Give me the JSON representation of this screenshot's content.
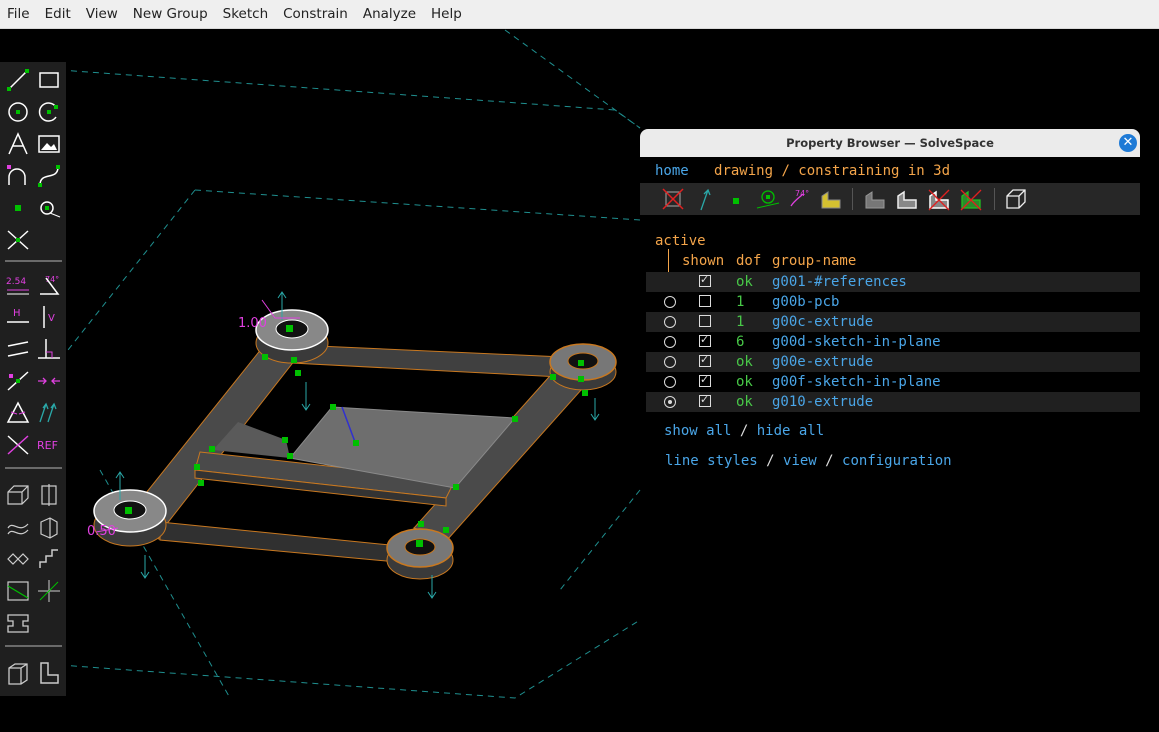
{
  "menubar": {
    "items": [
      "File",
      "Edit",
      "View",
      "New Group",
      "Sketch",
      "Constrain",
      "Analyze",
      "Help"
    ]
  },
  "viewport": {
    "dimension_labels": [
      "1.00",
      "0.50"
    ]
  },
  "toolbar": {
    "icons": [
      "line-icon",
      "rectangle-icon",
      "circle-icon",
      "arc-icon",
      "text-icon",
      "image-icon",
      "tangent-arc-icon",
      "bezier-icon",
      "point-icon",
      "workplane-icon",
      "split-icon",
      "distance-icon",
      "angle-icon",
      "horizontal-icon",
      "vertical-icon",
      "parallel-icon",
      "perpendicular-icon",
      "point-on-icon",
      "symmetric-icon",
      "equal-icon",
      "same-orientation-icon",
      "other-supplement-icon",
      "reference-icon",
      "extrude-icon",
      "lathe-icon",
      "helix-icon",
      "revolve-icon",
      "step-translate-icon",
      "step-rotate-icon",
      "workplane-sketch-icon",
      "sketch-3d-icon",
      "link-icon",
      "assemble-icon",
      "new-group-icon"
    ],
    "text_labels": {
      "distance": "2.54",
      "angle": "74°",
      "horizontal": "H",
      "vertical": "V",
      "reference": "REF"
    },
    "angle_label": "74°"
  },
  "property_browser": {
    "title": "Property Browser — SolveSpace",
    "close_label": "✕",
    "nav": {
      "home": "home",
      "status": "drawing / constraining in 3d"
    },
    "icon_bar": [
      "occluded-lines-icon",
      "constraints-icon",
      "points-icon",
      "workplanes-icon",
      "faces-icon",
      "shaded-icon",
      "hidden-lines-icon",
      "outline-icon",
      "edges-icon",
      "mesh-icon",
      "perspective-icon"
    ],
    "active_label": "active",
    "col_headers": {
      "shown": "shown",
      "dof": "dof",
      "name": "group-name"
    },
    "groups": [
      {
        "active": "none",
        "shown": true,
        "dof": "ok",
        "name": "g001-#references"
      },
      {
        "active": "radio",
        "shown": false,
        "dof": "1",
        "name": "g00b-pcb"
      },
      {
        "active": "radio",
        "shown": false,
        "dof": "1",
        "name": "g00c-extrude"
      },
      {
        "active": "radio",
        "shown": true,
        "dof": "6",
        "name": "g00d-sketch-in-plane"
      },
      {
        "active": "radio",
        "shown": true,
        "dof": "ok",
        "name": "g00e-extrude"
      },
      {
        "active": "radio",
        "shown": true,
        "dof": "ok",
        "name": "g00f-sketch-in-plane"
      },
      {
        "active": "selected",
        "shown": true,
        "dof": "ok",
        "name": "g010-extrude"
      }
    ],
    "links": {
      "show_all": "show all",
      "sep1": " / ",
      "hide_all": "hide all",
      "line_styles": "line styles",
      "sep2": " / ",
      "view": "view",
      "sep3": " / ",
      "configuration": "configuration"
    }
  },
  "colors": {
    "background": "#000000",
    "link": "#4aa6e8",
    "status_orange": "#f4a54a",
    "ok_green": "#48c848",
    "toolbar_bg": "#1f1f1f",
    "constraint_magenta": "#e040e0",
    "point_green": "#00c000",
    "edge_orange": "#c87820"
  }
}
